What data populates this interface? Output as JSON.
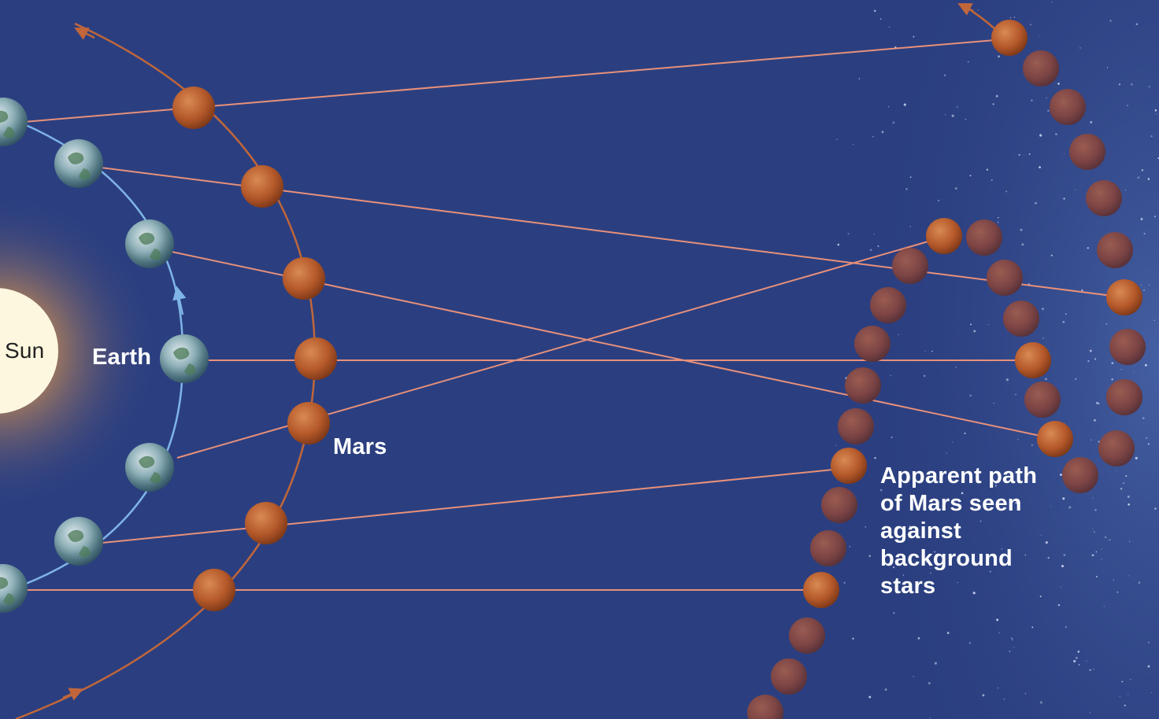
{
  "labels": {
    "sun": "Sun",
    "earth": "Earth",
    "mars": "Mars",
    "apparent_path": "Apparent path of Mars seen against background stars"
  },
  "colors": {
    "sky": "#2b3f80",
    "earth_orbit": "#7fb4e6",
    "mars_orbit": "#c0663a",
    "sight_line": "#e8907a",
    "mars": "#b4582a",
    "sun": "#fdf7df"
  },
  "icons": {
    "sun": "sun-icon",
    "earth": "earth-icon",
    "mars": "mars-icon",
    "star": "star-dot-icon"
  }
}
